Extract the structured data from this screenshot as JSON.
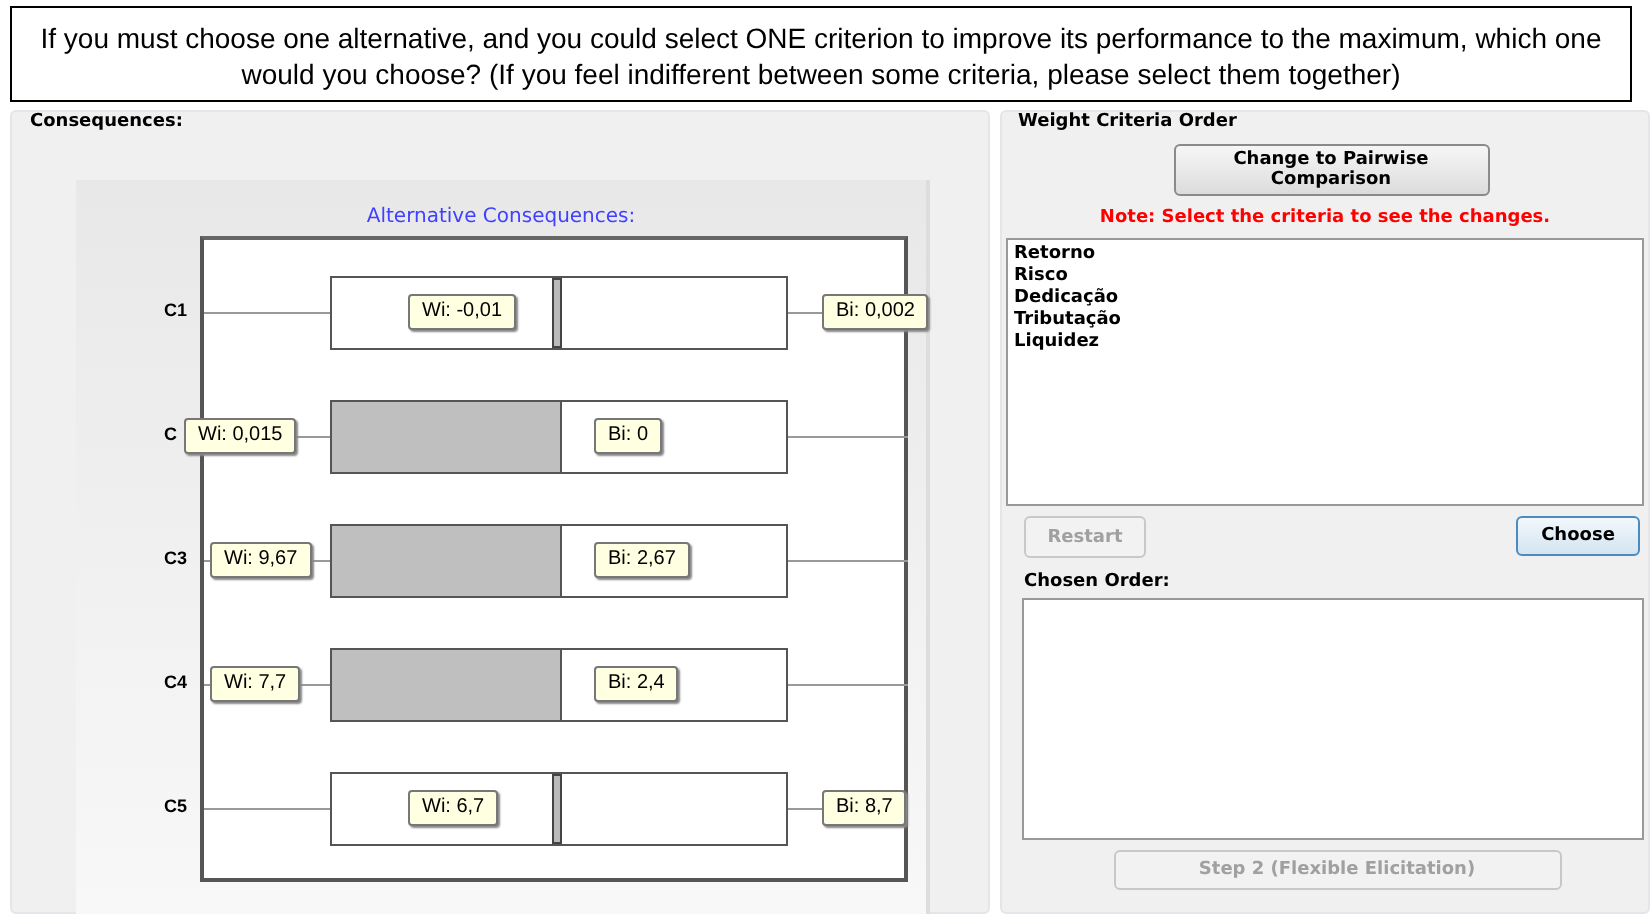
{
  "question": "If you must choose one alternative, and you could select ONE criterion to improve its performance to the maximum, which one would you choose? (If you feel indifferent between some criteria, please select them together)",
  "consequences": {
    "title": "Consequences:",
    "chart_title": "Alternative Consequences:",
    "rows": [
      {
        "label": "C1",
        "kind": "marker",
        "wi": "Wi: -0,01",
        "bi": "Bi: 0,002"
      },
      {
        "label": "C",
        "kind": "split",
        "wi": "Wi: 0,015",
        "bi": "Bi: 0"
      },
      {
        "label": "C3",
        "kind": "split",
        "wi": "Wi: 9,67",
        "bi": "Bi: 2,67"
      },
      {
        "label": "C4",
        "kind": "split",
        "wi": "Wi: 7,7",
        "bi": "Bi: 2,4"
      },
      {
        "label": "C5",
        "kind": "marker",
        "wi": "Wi: 6,7",
        "bi": "Bi: 8,7"
      }
    ]
  },
  "weight_panel": {
    "title": "Weight Criteria Order",
    "pairwise_button": "Change to Pairwise Comparison",
    "note": "Note: Select the criteria to see the changes.",
    "criteria": [
      "Retorno",
      "Risco",
      "Dedicação",
      "Tributação",
      "Liquidez"
    ],
    "restart_button": {
      "label": "Restart",
      "disabled": true
    },
    "choose_button": {
      "label": "Choose",
      "disabled": false
    },
    "chosen_order_label": "Chosen Order:",
    "step2_button": {
      "label": "Step 2 (Flexible Elicitation)",
      "disabled": true
    }
  }
}
